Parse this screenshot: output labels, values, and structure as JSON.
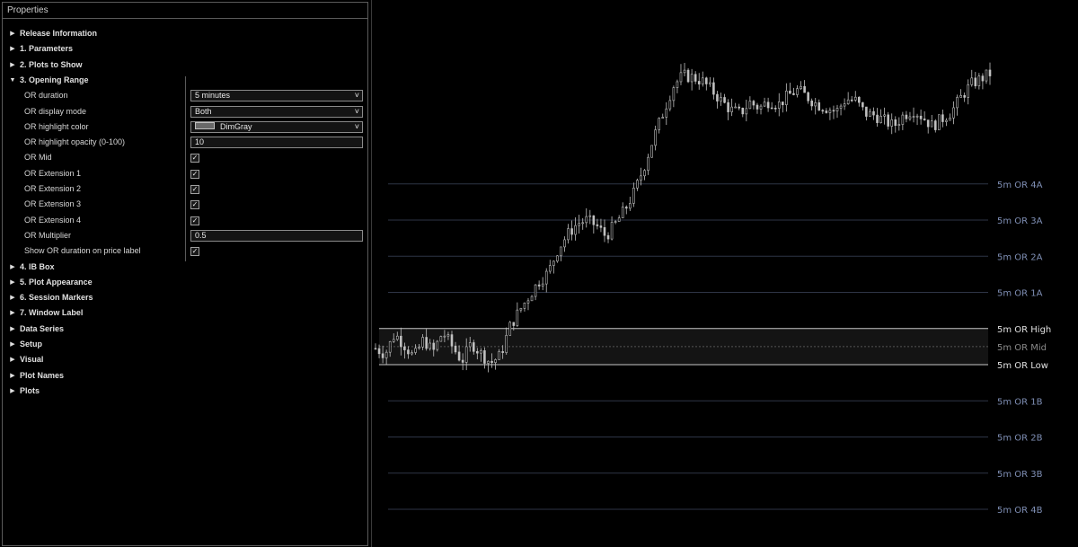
{
  "properties": {
    "title": "Properties",
    "rows": [
      {
        "kind": "cat",
        "label": "Release Information",
        "open": false
      },
      {
        "kind": "cat",
        "label": "1. Parameters",
        "open": false
      },
      {
        "kind": "cat",
        "label": "2. Plots to Show",
        "open": false
      },
      {
        "kind": "cat",
        "label": "3. Opening Range",
        "open": true
      },
      {
        "kind": "prop",
        "label": "OR duration",
        "control": "select",
        "value": "5 minutes"
      },
      {
        "kind": "prop",
        "label": "OR display mode",
        "control": "select",
        "value": "Both"
      },
      {
        "kind": "prop",
        "label": "OR highlight color",
        "control": "color",
        "value": "DimGray",
        "swatch": "#696969"
      },
      {
        "kind": "prop",
        "label": "OR highlight opacity (0-100)",
        "control": "text",
        "value": "10"
      },
      {
        "kind": "prop",
        "label": "OR Mid",
        "control": "check",
        "checked": true
      },
      {
        "kind": "prop",
        "label": "OR Extension 1",
        "control": "check",
        "checked": true
      },
      {
        "kind": "prop",
        "label": "OR Extension 2",
        "control": "check",
        "checked": true
      },
      {
        "kind": "prop",
        "label": "OR Extension 3",
        "control": "check",
        "checked": true
      },
      {
        "kind": "prop",
        "label": "OR Extension 4",
        "control": "check",
        "checked": true
      },
      {
        "kind": "prop",
        "label": "OR Multiplier",
        "control": "text",
        "value": "0.5"
      },
      {
        "kind": "prop",
        "label": "Show OR duration on price label",
        "control": "check",
        "checked": true
      },
      {
        "kind": "cat",
        "label": "4. IB Box",
        "open": false
      },
      {
        "kind": "cat",
        "label": "5. Plot Appearance",
        "open": false
      },
      {
        "kind": "cat",
        "label": "6. Session Markers",
        "open": false
      },
      {
        "kind": "cat",
        "label": "7. Window Label",
        "open": false
      },
      {
        "kind": "cat",
        "label": "Data Series",
        "open": false
      },
      {
        "kind": "cat",
        "label": "Setup",
        "open": false
      },
      {
        "kind": "cat",
        "label": "Visual",
        "open": false
      },
      {
        "kind": "cat",
        "label": "Plot Names",
        "open": false
      },
      {
        "kind": "cat",
        "label": "Plots",
        "open": false
      }
    ]
  },
  "chart": {
    "colors": {
      "level": "#7f8fb5",
      "or_line": "#c8c8c8",
      "mid_label": "#8a8a8a",
      "box": "#141414",
      "candle": "#c0c0c0",
      "grid": "#2e3546"
    },
    "levels": [
      {
        "label": "5m OR 4A",
        "value": 5,
        "kind": "ext"
      },
      {
        "label": "5m OR 3A",
        "value": 4,
        "kind": "ext"
      },
      {
        "label": "5m OR 2A",
        "value": 3,
        "kind": "ext"
      },
      {
        "label": "5m OR 1A",
        "value": 2,
        "kind": "ext"
      },
      {
        "label": "5m OR High",
        "value": 1,
        "kind": "high"
      },
      {
        "label": "5m OR Mid",
        "value": 0.5,
        "kind": "mid"
      },
      {
        "label": "5m OR Low",
        "value": 0,
        "kind": "low"
      },
      {
        "label": "5m OR 1B",
        "value": -1,
        "kind": "ext"
      },
      {
        "label": "5m OR 2B",
        "value": -2,
        "kind": "ext"
      },
      {
        "label": "5m OR 3B",
        "value": -3,
        "kind": "ext"
      },
      {
        "label": "5m OR 4B",
        "value": -4,
        "kind": "ext"
      }
    ],
    "price_path": [
      0.45,
      0.3,
      0.85,
      0.55,
      0.2,
      0.7,
      0.35,
      0.9,
      0.5,
      0.1,
      0.6,
      0.3,
      0.05,
      0.25,
      1.05,
      1.5,
      1.9,
      2.3,
      2.55,
      3.2,
      3.6,
      3.9,
      4.0,
      3.85,
      3.55,
      3.9,
      4.3,
      4.8,
      5.5,
      6.3,
      7.0,
      7.7,
      8.0,
      7.95,
      7.85,
      7.6,
      7.3,
      7.05,
      6.95,
      7.25,
      7.1,
      7.3,
      7.2,
      7.45,
      7.6,
      7.4,
      7.2,
      7.1,
      7.0,
      7.35,
      7.3,
      6.95,
      6.9,
      6.75,
      6.6,
      6.9,
      7.05,
      6.85,
      6.6,
      6.8,
      7.0,
      7.4,
      7.75,
      7.9,
      8.05
    ]
  }
}
